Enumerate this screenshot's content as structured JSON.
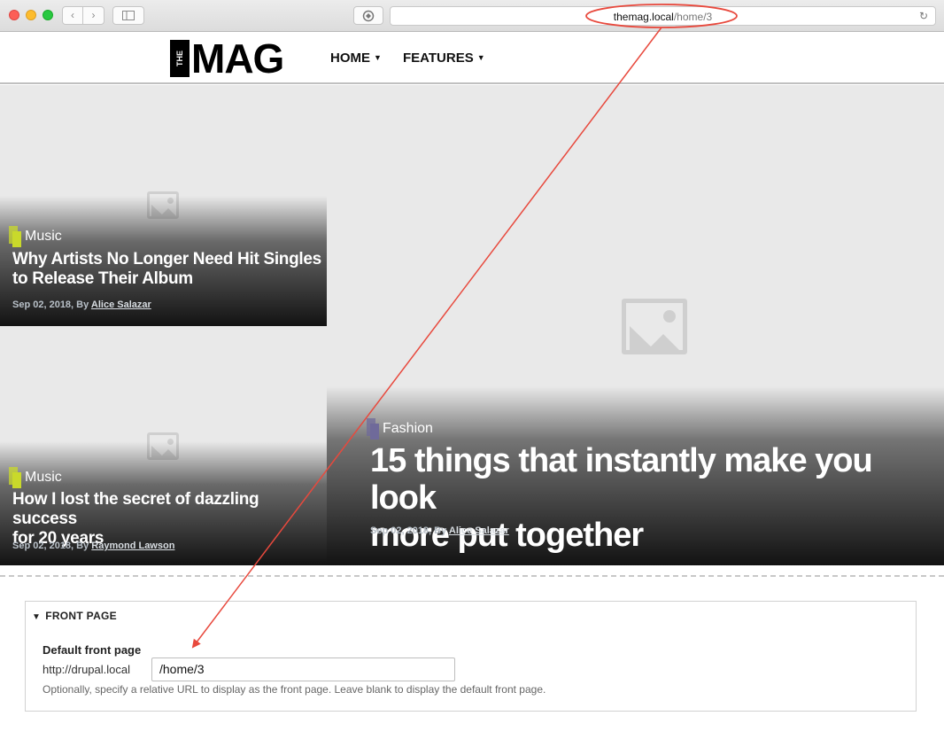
{
  "browser": {
    "url_host": "themag.local",
    "url_path": "/home/3",
    "back_glyph": "‹",
    "forward_glyph": "›",
    "reload_glyph": "↻"
  },
  "site": {
    "logo_small": "THE",
    "logo_main": "MAG",
    "nav": [
      {
        "label": "HOME"
      },
      {
        "label": "FEATURES"
      }
    ]
  },
  "hero": {
    "cards": [
      {
        "category": "Music",
        "category_color": "#c9d92b",
        "title_lines": [
          "Why Artists No Longer Need Hit Singles",
          "to Release Their Album"
        ],
        "date": "Sep 02, 2018, By",
        "author": "Alice Salazar"
      },
      {
        "category": "Music",
        "category_color": "#c9d92b",
        "title_lines": [
          "How I lost the secret of dazzling success",
          "for 20 years"
        ],
        "date": "Sep 02, 2018, By",
        "author": "Raymond Lawson"
      },
      {
        "category": "Fashion",
        "category_color": "#6f6a9a",
        "title_lines": [
          "15 things that instantly make you look",
          "more put together"
        ],
        "date": "Sep 02, 2018, By",
        "author": "Alice Salazar"
      }
    ]
  },
  "form": {
    "section_title": "FRONT PAGE",
    "field_label": "Default front page",
    "prefix": "http://drupal.local",
    "value": "/home/3",
    "description": "Optionally, specify a relative URL to display as the front page. Leave blank to display the default front page."
  },
  "colors": {
    "annotation": "#e8493d"
  }
}
